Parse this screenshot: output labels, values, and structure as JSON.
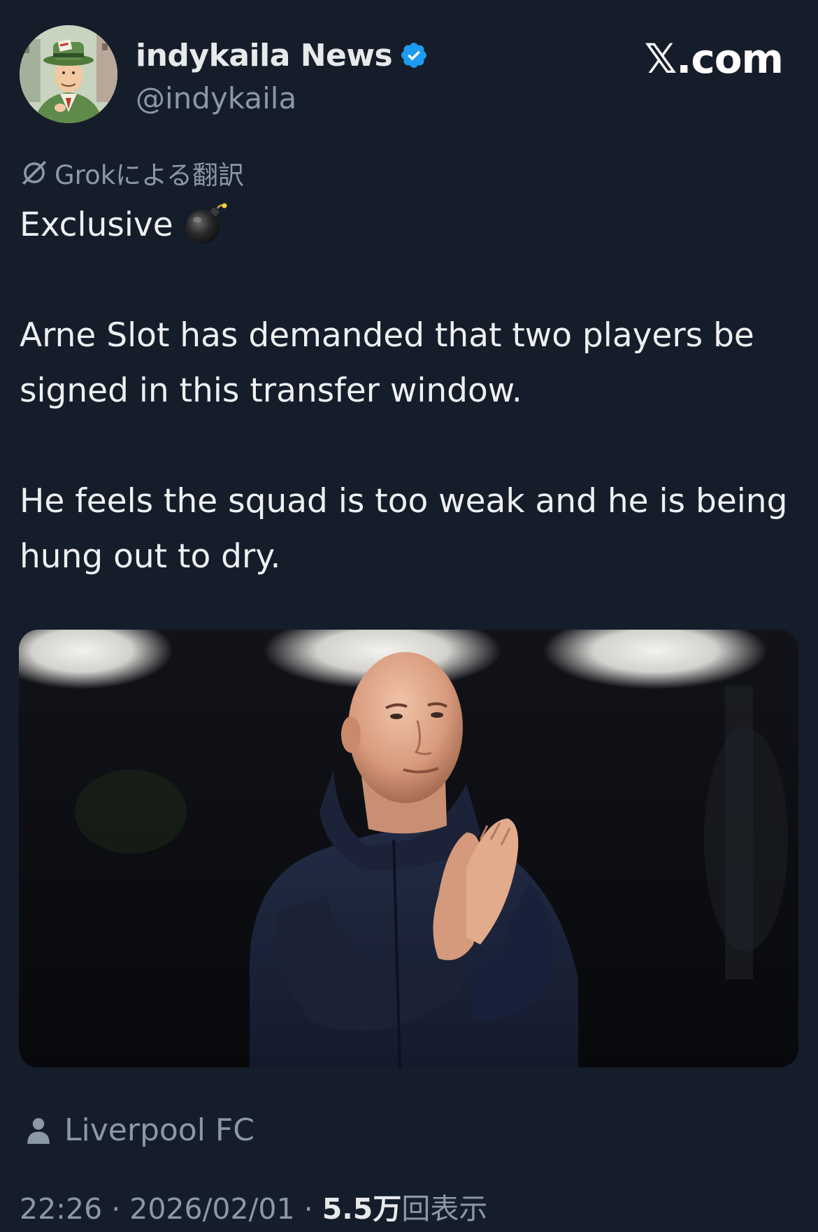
{
  "author": {
    "display_name": "indykaila News",
    "handle": "@indykaila",
    "verified": true
  },
  "brand": "𝕏.com",
  "translation_label": "Grokによる翻訳",
  "tweet": {
    "line1": "Exclusive",
    "paragraph2": "Arne Slot has demanded that two players be signed in this transfer window.",
    "paragraph3": "He feels the squad is too weak and he is being hung out to dry."
  },
  "location": "Liverpool FC",
  "meta": {
    "time": "22:26",
    "separator": " · ",
    "date": "2026/02/01",
    "views_count": "5.5万",
    "views_label": "回表示"
  },
  "colors": {
    "background": "#161d2a",
    "text": "#e7e9ea",
    "secondary": "#8b98a5",
    "verified_badge": "#1d9bf0"
  },
  "icons": {
    "verified": "verified-badge-icon",
    "translate": "grok-slash-icon",
    "emoji": "bomb-emoji",
    "location": "person-icon"
  }
}
